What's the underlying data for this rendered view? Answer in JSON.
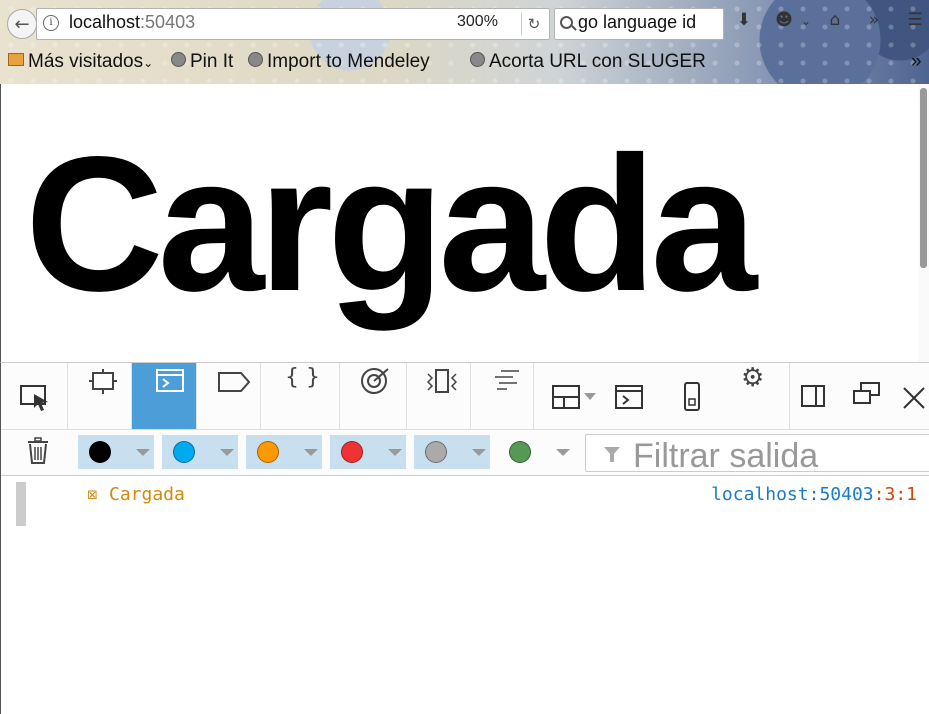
{
  "browser": {
    "url_host": "localhost",
    "url_port": ":50403",
    "zoom": "300%",
    "search_text": "go language id",
    "bookmarks": [
      {
        "label": "Más visitados",
        "icon": "folder-icon"
      },
      {
        "label": "Pin It",
        "icon": "globe-icon"
      },
      {
        "label": "Import to Mendeley",
        "icon": "globe-icon"
      },
      {
        "label": "Acorta URL con SLUGER",
        "icon": "globe-icon"
      }
    ],
    "overflow": "»"
  },
  "page": {
    "heading": "Cargada"
  },
  "devtools": {
    "tools": [
      "inspector",
      "console",
      "debugger",
      "style-editor",
      "performance",
      "memory",
      "network"
    ],
    "active_tool": "console",
    "filter_placeholder": "Filtrar salida",
    "levels": [
      {
        "name": "errors",
        "color": "#000000",
        "enabled": true
      },
      {
        "name": "warnings",
        "color": "#00aaee",
        "enabled": true
      },
      {
        "name": "info",
        "color": "#ff9900",
        "enabled": true
      },
      {
        "name": "logs",
        "color": "#ee3333",
        "enabled": true
      },
      {
        "name": "debug",
        "color": "#aaaaaa",
        "enabled": true
      },
      {
        "name": "css",
        "color": "#559955",
        "enabled": false
      }
    ]
  },
  "console": {
    "messages": [
      {
        "text": "Cargada",
        "icon": "⊠",
        "source_host": "localhost:50403",
        "source_pos": ":3:1"
      }
    ]
  }
}
